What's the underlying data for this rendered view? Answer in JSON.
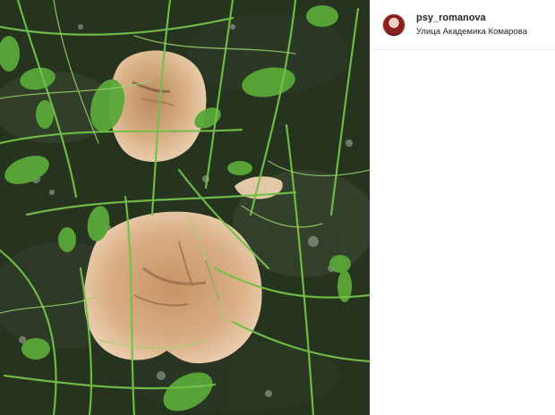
{
  "post": {
    "username": "psy_romanova",
    "location": "Улица Академика Комарова",
    "avatar_icon": "profile-avatar",
    "photo_alt": "mushrooms in grass"
  },
  "colors": {
    "grass_dark": "#1f2a1b",
    "grass_green": "#5fae3b",
    "mushroom_cap": "#c99a6a",
    "mushroom_light": "#e8c9a6"
  }
}
